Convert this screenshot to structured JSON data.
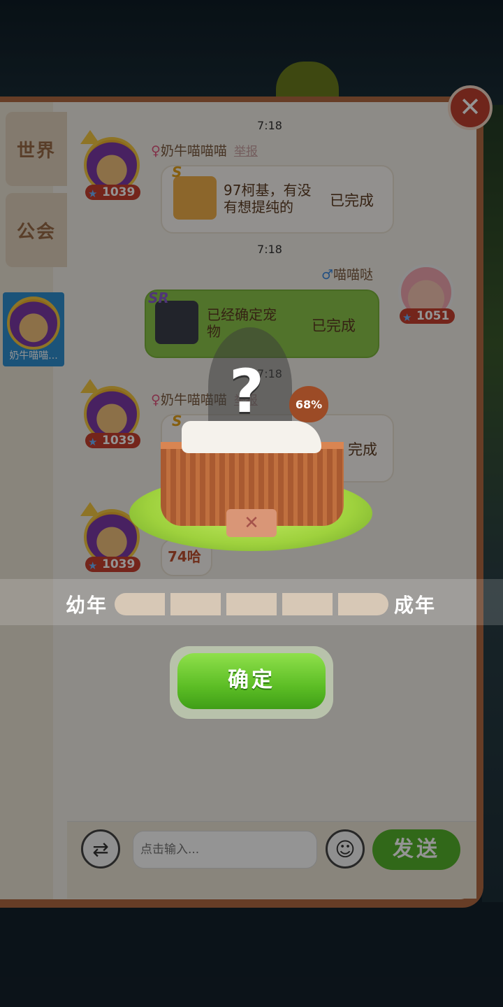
{
  "tabs": [
    {
      "label": "世界"
    },
    {
      "label": "公会"
    }
  ],
  "sidebar_user": {
    "name": "奶牛喵喵..."
  },
  "messages": [
    {
      "time": "7:18",
      "sender": "奶牛喵喵喵",
      "gender": "♀",
      "level": "1039",
      "report": "举报",
      "pet_rarity": "S",
      "text_line1": "97柯基，有没",
      "text_line2": "有想提纯的",
      "status": "已完成"
    },
    {
      "time": "7:18",
      "sender": "喵喵哒",
      "gender": "♂",
      "level": "1051",
      "pet_rarity": "SR",
      "text_line1": "已经确定宠",
      "text_line2": "物",
      "status": "已完成"
    },
    {
      "time": "7:18",
      "sender": "奶牛喵喵喵",
      "gender": "♀",
      "level": "1039",
      "report": "举报",
      "pet_rarity": "S",
      "status": "完成"
    },
    {
      "level": "1039",
      "text": "74哈"
    }
  ],
  "input": {
    "placeholder": "点击输入..."
  },
  "send_label": "发送",
  "popup": {
    "question": "?",
    "percent": "68%",
    "growth_start": "幼年",
    "growth_end": "成年",
    "growth_segments": 5,
    "confirm_label": "确定"
  },
  "icons": {
    "close": "close-icon",
    "switch": "swap-arrows-icon",
    "emoji": "smiley-icon",
    "level_star": "star-icon"
  }
}
